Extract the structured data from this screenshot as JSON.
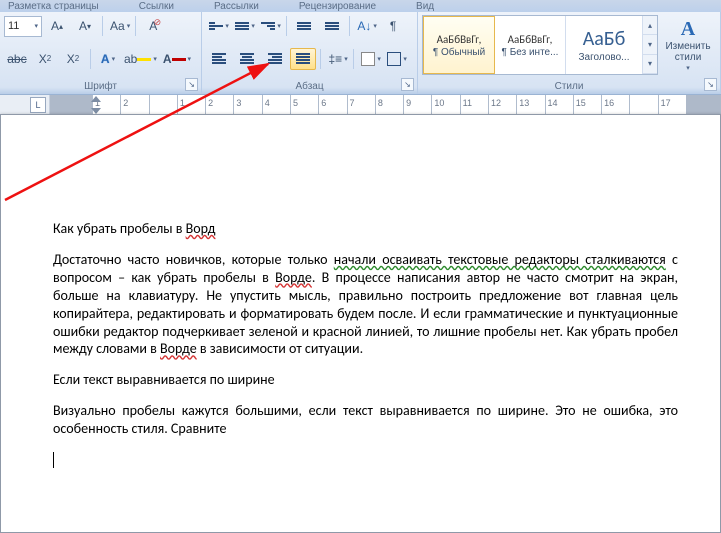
{
  "tabs": {
    "page_layout": "Разметка страницы",
    "links": "Ссылки",
    "mailings": "Рассылки",
    "review": "Рецензирование",
    "view": "Вид"
  },
  "font_group": {
    "label": "Шрифт",
    "size_value": "11"
  },
  "paragraph_group": {
    "label": "Абзац"
  },
  "styles_group": {
    "label": "Стили",
    "tiles": [
      {
        "preview": "АаБбВвГг,",
        "preview_size": "11px",
        "name": "¶ Обычный"
      },
      {
        "preview": "АаБбВвГг,",
        "preview_size": "11px",
        "name": "¶ Без инте..."
      },
      {
        "preview": "АаБб",
        "preview_size": "20px",
        "name": "Заголово..."
      }
    ],
    "change_styles_label": "Изменить\nстили"
  },
  "ruler": {
    "numbers": [
      "1",
      "2",
      "",
      "1",
      "2",
      "3",
      "4",
      "5",
      "6",
      "7",
      "8",
      "9",
      "10",
      "11",
      "12",
      "13",
      "14",
      "15",
      "16",
      "",
      "17"
    ]
  },
  "doc": {
    "p1": "Как убрать пробелы в ",
    "p1_u": "Ворд",
    "p2a": "Достаточно часто новичков, которые только ",
    "p2u1": "начали осваивать текстовые редакторы сталкиваются",
    "p2b": " с вопросом – как убрать пробелы в ",
    "p2u2": "Ворде",
    "p2c": ". В процессе написания автор не часто смотрит на экран, больше на клавиатуру. Не упустить мысль, правильно построить предложение вот главная цель копирайтера, редактировать и форматировать будем после. И если грамматические и пунктуационные ошибки редактор подчеркивает зеленой и красной линией, то лишние пробелы нет. Как убрать пробел между словами в ",
    "p2u3": "Ворде",
    "p2d": " в зависимости от ситуации.",
    "p3": "Если текст выравнивается по ширине",
    "p4": "Визуально пробелы кажутся большими, если текст выравнивается по ширине. Это не ошибка, это особенность стиля. Сравните"
  }
}
